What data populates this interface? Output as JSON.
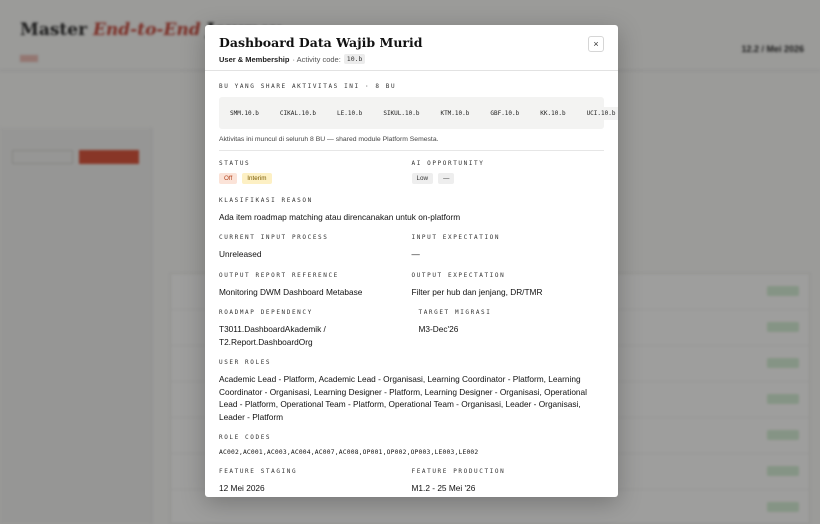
{
  "modal": {
    "title": "Dashboard Data Wajib Murid",
    "category": "User & Membership",
    "code_label": "· Activity code:",
    "code": "10.b",
    "close_label": "×",
    "bu_section_label": "BU YANG SHARE AKTIVITAS INI · 8 BU",
    "bu_codes": [
      "SMM.10.b",
      "CIKAL.10.b",
      "LE.10.b",
      "SIKUL.10.b",
      "KTM.10.b",
      "GBF.10.b",
      "KK.10.b",
      "UCI.10.b"
    ],
    "bu_note": "Aktivitas ini muncul di seluruh 8 BU — shared module Platform Semesta.",
    "status_label": "STATUS",
    "status_badges": [
      "Off",
      "Interim"
    ],
    "ai_label": "AI OPPORTUNITY",
    "ai_badges": [
      "Low",
      "—"
    ],
    "klasifikasi_label": "KLASIFIKASI REASON",
    "klasifikasi_value": "Ada item roadmap matching atau direncanakan untuk on-platform",
    "current_input_label": "CURRENT INPUT PROCESS",
    "current_input_value": "Unreleased",
    "input_expectation_label": "INPUT EXPECTATION",
    "input_expectation_value": "—",
    "output_report_label": "OUTPUT REPORT REFERENCE",
    "output_report_value": "Monitoring DWM Dashboard Metabase",
    "output_expectation_label": "OUTPUT EXPECTATION",
    "output_expectation_value": "Filter per hub dan jenjang, DR/TMR",
    "roadmap_label": "ROADMAP DEPENDENCY",
    "roadmap_value": "T3011.DashboardAkademik / T2.Report.DashboardOrg",
    "target_label": "TARGET MIGRASI",
    "target_value": "M3-Dec'26",
    "user_roles_label": "USER ROLES",
    "user_roles_value": "Academic Lead - Platform, Academic Lead - Organisasi, Learning Coordinator - Platform, Learning Coordinator - Organisasi, Learning Designer - Platform, Learning Designer - Organisasi, Operational Lead - Platform, Operational Team - Platform, Operational Team - Organisasi, Leader - Organisasi, Leader - Platform",
    "role_codes_label": "ROLE CODES",
    "role_codes_value": "AC002,AC001,AC003,AC004,AC007,AC008,OP001,OP002,OP003,LE003,LE002",
    "feature_staging_label": "FEATURE STAGING",
    "feature_staging_value": "12 Mei 2026",
    "feature_production_label": "FEATURE PRODUCTION",
    "feature_production_value": "M1.2 - 25 Mei '26"
  },
  "background": {
    "title_prefix": "Master",
    "title_italic": "End-to-End",
    "title_suffix": "Journey",
    "date": "12.2 / Mei 2026"
  },
  "colors": {
    "accent_red": "#d4472d",
    "status_off_bg": "#fbe3d8",
    "status_interim_bg": "#fdf0c4"
  }
}
